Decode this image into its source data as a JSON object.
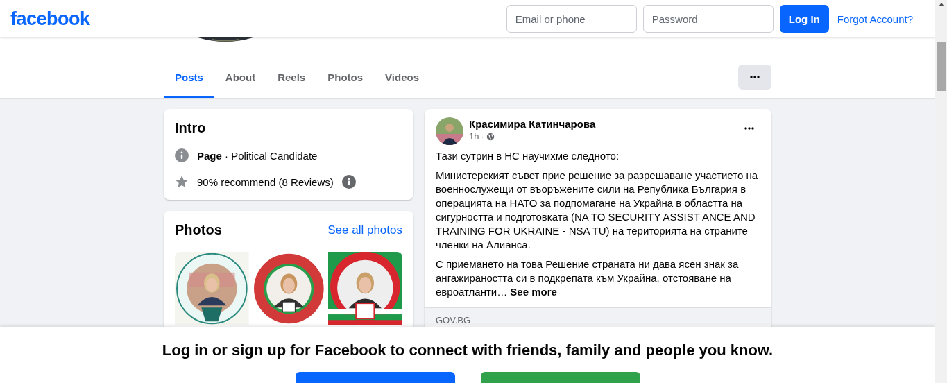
{
  "header": {
    "logo": "facebook",
    "email": {
      "placeholder": "Email or phone"
    },
    "password": {
      "placeholder": "Password"
    },
    "login_button": "Log In",
    "forgot_link": "Forgot Account?"
  },
  "tabs": [
    {
      "label": "Posts",
      "selected": true
    },
    {
      "label": "About",
      "selected": false
    },
    {
      "label": "Reels",
      "selected": false
    },
    {
      "label": "Photos",
      "selected": false
    },
    {
      "label": "Videos",
      "selected": false
    }
  ],
  "intro": {
    "title": "Intro",
    "items": [
      {
        "kind": "category",
        "text": "**Page** · Political Candidate"
      },
      {
        "kind": "rating",
        "text": "90% recommend (8 Reviews)"
      }
    ]
  },
  "photos": {
    "title": "Photos",
    "link": "See all photos"
  },
  "post": {
    "author": "Красимира Катинчарова",
    "time": "1h",
    "time_separator": "·",
    "paragraphs": [
      "Тази сутрин в НС научихме следното:",
      "Министерският съвет прие решение за разрешаване участието на военнослужещи от въоръжените сили на Република България в операцията на НАТО за подпомагане на Украйна в областта на сигурността и подготовката (NA TO SECURITY ASSIST ANCE AND TRAINING FOR UKRAINE - NSA TU) на територията на страните членки на Алианса.",
      "С приемането на това Решение страната ни дава ясен знак за ангажираността си в подкрепата към Украйна, отстояване на евроатланти…"
    ],
    "see_more": "See more",
    "link_domain": "GOV.BG"
  },
  "signup_banner": {
    "text": "Log in or sign up for Facebook to connect with friends, family and people you know."
  }
}
